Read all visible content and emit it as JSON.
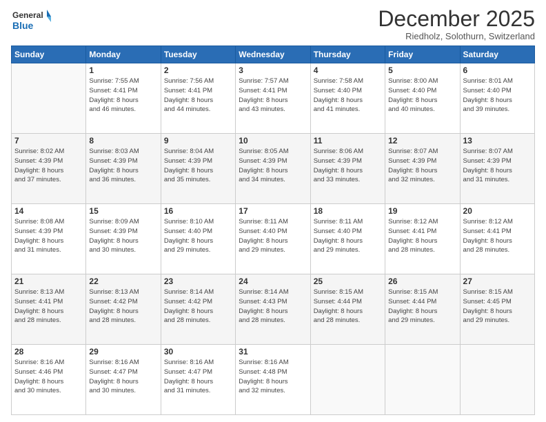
{
  "header": {
    "logo_line1": "General",
    "logo_line2": "Blue",
    "month": "December 2025",
    "location": "Riedholz, Solothurn, Switzerland"
  },
  "days_of_week": [
    "Sunday",
    "Monday",
    "Tuesday",
    "Wednesday",
    "Thursday",
    "Friday",
    "Saturday"
  ],
  "weeks": [
    [
      {
        "day": "",
        "info": ""
      },
      {
        "day": "1",
        "info": "Sunrise: 7:55 AM\nSunset: 4:41 PM\nDaylight: 8 hours\nand 46 minutes."
      },
      {
        "day": "2",
        "info": "Sunrise: 7:56 AM\nSunset: 4:41 PM\nDaylight: 8 hours\nand 44 minutes."
      },
      {
        "day": "3",
        "info": "Sunrise: 7:57 AM\nSunset: 4:41 PM\nDaylight: 8 hours\nand 43 minutes."
      },
      {
        "day": "4",
        "info": "Sunrise: 7:58 AM\nSunset: 4:40 PM\nDaylight: 8 hours\nand 41 minutes."
      },
      {
        "day": "5",
        "info": "Sunrise: 8:00 AM\nSunset: 4:40 PM\nDaylight: 8 hours\nand 40 minutes."
      },
      {
        "day": "6",
        "info": "Sunrise: 8:01 AM\nSunset: 4:40 PM\nDaylight: 8 hours\nand 39 minutes."
      }
    ],
    [
      {
        "day": "7",
        "info": "Sunrise: 8:02 AM\nSunset: 4:39 PM\nDaylight: 8 hours\nand 37 minutes."
      },
      {
        "day": "8",
        "info": "Sunrise: 8:03 AM\nSunset: 4:39 PM\nDaylight: 8 hours\nand 36 minutes."
      },
      {
        "day": "9",
        "info": "Sunrise: 8:04 AM\nSunset: 4:39 PM\nDaylight: 8 hours\nand 35 minutes."
      },
      {
        "day": "10",
        "info": "Sunrise: 8:05 AM\nSunset: 4:39 PM\nDaylight: 8 hours\nand 34 minutes."
      },
      {
        "day": "11",
        "info": "Sunrise: 8:06 AM\nSunset: 4:39 PM\nDaylight: 8 hours\nand 33 minutes."
      },
      {
        "day": "12",
        "info": "Sunrise: 8:07 AM\nSunset: 4:39 PM\nDaylight: 8 hours\nand 32 minutes."
      },
      {
        "day": "13",
        "info": "Sunrise: 8:07 AM\nSunset: 4:39 PM\nDaylight: 8 hours\nand 31 minutes."
      }
    ],
    [
      {
        "day": "14",
        "info": "Sunrise: 8:08 AM\nSunset: 4:39 PM\nDaylight: 8 hours\nand 31 minutes."
      },
      {
        "day": "15",
        "info": "Sunrise: 8:09 AM\nSunset: 4:39 PM\nDaylight: 8 hours\nand 30 minutes."
      },
      {
        "day": "16",
        "info": "Sunrise: 8:10 AM\nSunset: 4:40 PM\nDaylight: 8 hours\nand 29 minutes."
      },
      {
        "day": "17",
        "info": "Sunrise: 8:11 AM\nSunset: 4:40 PM\nDaylight: 8 hours\nand 29 minutes."
      },
      {
        "day": "18",
        "info": "Sunrise: 8:11 AM\nSunset: 4:40 PM\nDaylight: 8 hours\nand 29 minutes."
      },
      {
        "day": "19",
        "info": "Sunrise: 8:12 AM\nSunset: 4:41 PM\nDaylight: 8 hours\nand 28 minutes."
      },
      {
        "day": "20",
        "info": "Sunrise: 8:12 AM\nSunset: 4:41 PM\nDaylight: 8 hours\nand 28 minutes."
      }
    ],
    [
      {
        "day": "21",
        "info": "Sunrise: 8:13 AM\nSunset: 4:41 PM\nDaylight: 8 hours\nand 28 minutes."
      },
      {
        "day": "22",
        "info": "Sunrise: 8:13 AM\nSunset: 4:42 PM\nDaylight: 8 hours\nand 28 minutes."
      },
      {
        "day": "23",
        "info": "Sunrise: 8:14 AM\nSunset: 4:42 PM\nDaylight: 8 hours\nand 28 minutes."
      },
      {
        "day": "24",
        "info": "Sunrise: 8:14 AM\nSunset: 4:43 PM\nDaylight: 8 hours\nand 28 minutes."
      },
      {
        "day": "25",
        "info": "Sunrise: 8:15 AM\nSunset: 4:44 PM\nDaylight: 8 hours\nand 28 minutes."
      },
      {
        "day": "26",
        "info": "Sunrise: 8:15 AM\nSunset: 4:44 PM\nDaylight: 8 hours\nand 29 minutes."
      },
      {
        "day": "27",
        "info": "Sunrise: 8:15 AM\nSunset: 4:45 PM\nDaylight: 8 hours\nand 29 minutes."
      }
    ],
    [
      {
        "day": "28",
        "info": "Sunrise: 8:16 AM\nSunset: 4:46 PM\nDaylight: 8 hours\nand 30 minutes."
      },
      {
        "day": "29",
        "info": "Sunrise: 8:16 AM\nSunset: 4:47 PM\nDaylight: 8 hours\nand 30 minutes."
      },
      {
        "day": "30",
        "info": "Sunrise: 8:16 AM\nSunset: 4:47 PM\nDaylight: 8 hours\nand 31 minutes."
      },
      {
        "day": "31",
        "info": "Sunrise: 8:16 AM\nSunset: 4:48 PM\nDaylight: 8 hours\nand 32 minutes."
      },
      {
        "day": "",
        "info": ""
      },
      {
        "day": "",
        "info": ""
      },
      {
        "day": "",
        "info": ""
      }
    ]
  ]
}
